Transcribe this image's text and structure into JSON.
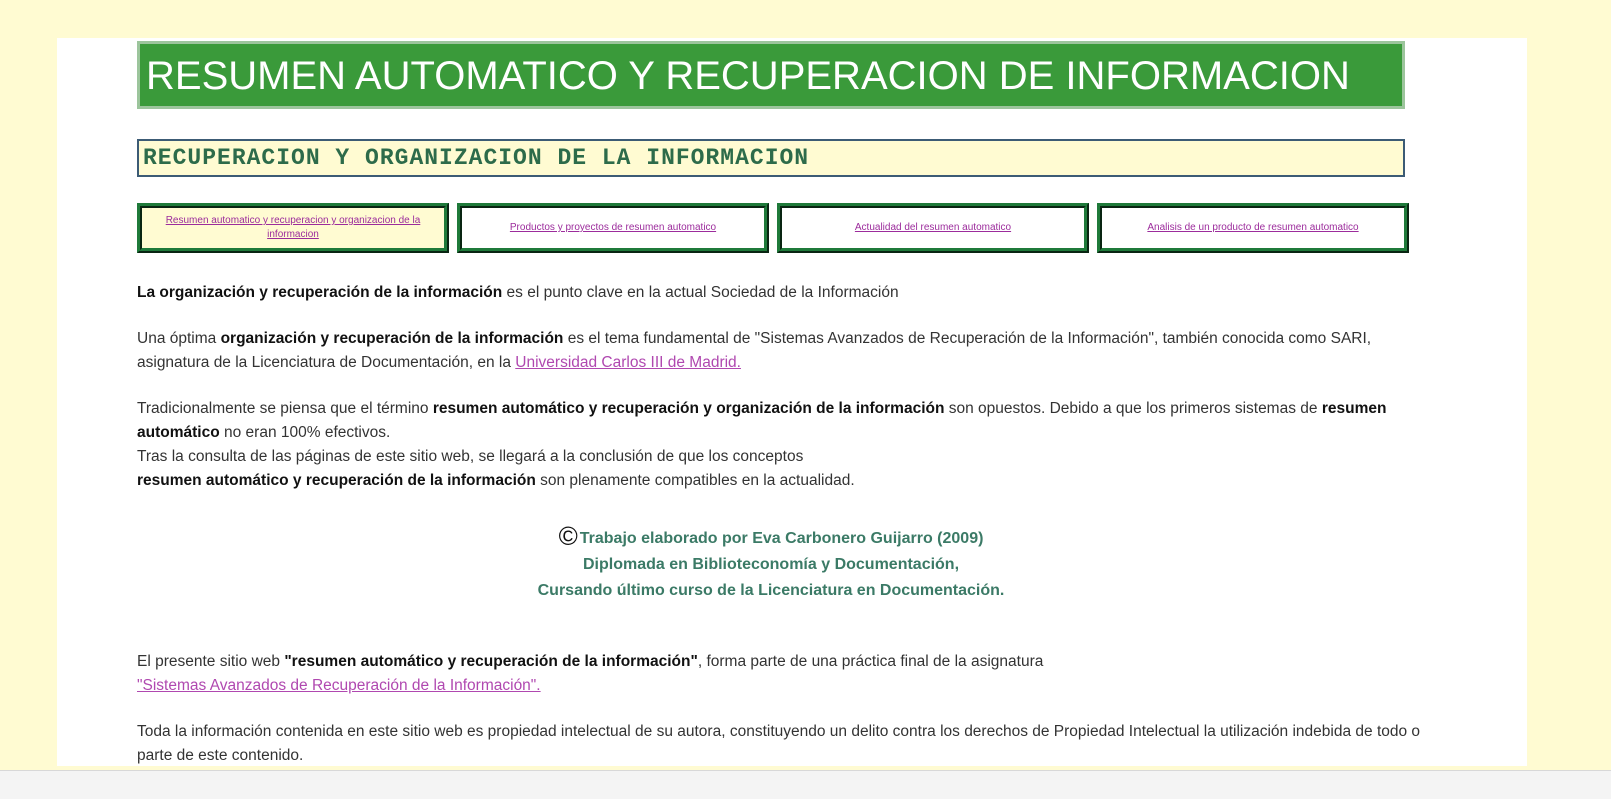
{
  "header": {
    "title": "RESUMEN AUTOMATICO Y RECUPERACION DE INFORMACION",
    "subtitle": "RECUPERACION Y ORGANIZACION DE LA INFORMACION"
  },
  "nav": {
    "items": [
      {
        "label": "Resumen automatico y recuperacion y organizacion de la informacion"
      },
      {
        "label": "Productos y proyectos de resumen automatico"
      },
      {
        "label": "Actualidad del resumen automatico"
      },
      {
        "label": "Analisis de un producto de resumen automatico"
      }
    ]
  },
  "body": {
    "p1": {
      "b1": "La organización y recuperación de la información",
      "t1": " es el punto clave en la actual Sociedad de la Información"
    },
    "p2": {
      "t1": "Una óptima ",
      "b1": "organización y recuperación de la información",
      "t2": " es el tema fundamental de \"Sistemas Avanzados de Recuperación de la Información\", también conocida como SARI, asignatura de la Licenciatura de Documentación, en la ",
      "link": "Universidad Carlos III de Madrid."
    },
    "p3": {
      "t1": "Tradicionalmente se piensa que el término ",
      "b1": "resumen automático y recuperación y organización de la información",
      "t2": " son opuestos. Debido a que los primeros sistemas de ",
      "b2": "resumen automático",
      "t3": " no eran 100% efectivos.",
      "line2": "Tras la consulta de las páginas de este sitio web, se llegará a la conclusión de que los conceptos",
      "b3": "resumen automático y recuperación de la información",
      "t4": " son plenamente compatibles en la actualidad."
    },
    "credits": {
      "icon": "©",
      "line1": "Trabajo elaborado por Eva Carbonero Guijarro (2009)",
      "line2": "Diplomada en Biblioteconomía y Documentación,",
      "line3": "Cursando último curso de la Licenciatura en Documentación."
    },
    "p4": {
      "t1": "El presente sitio web ",
      "b1": "\"resumen automático y recuperación de la información\"",
      "t2": ", forma parte de una práctica final de la asignatura ",
      "link": "\"Sistemas Avanzados de Recuperación de la Información\"."
    },
    "p5": {
      "t1": "Toda la información contenida en este sitio web es propiedad intelectual de su autora, constituyendo un delito contra los derechos de Propiedad Intelectual la utilización indebida de todo o parte de este contenido."
    }
  },
  "colors": {
    "page_background": "#fffbd2",
    "title_background": "#3a9a3a",
    "link": "#9c2c9c",
    "credits_text": "#3b7a66"
  }
}
